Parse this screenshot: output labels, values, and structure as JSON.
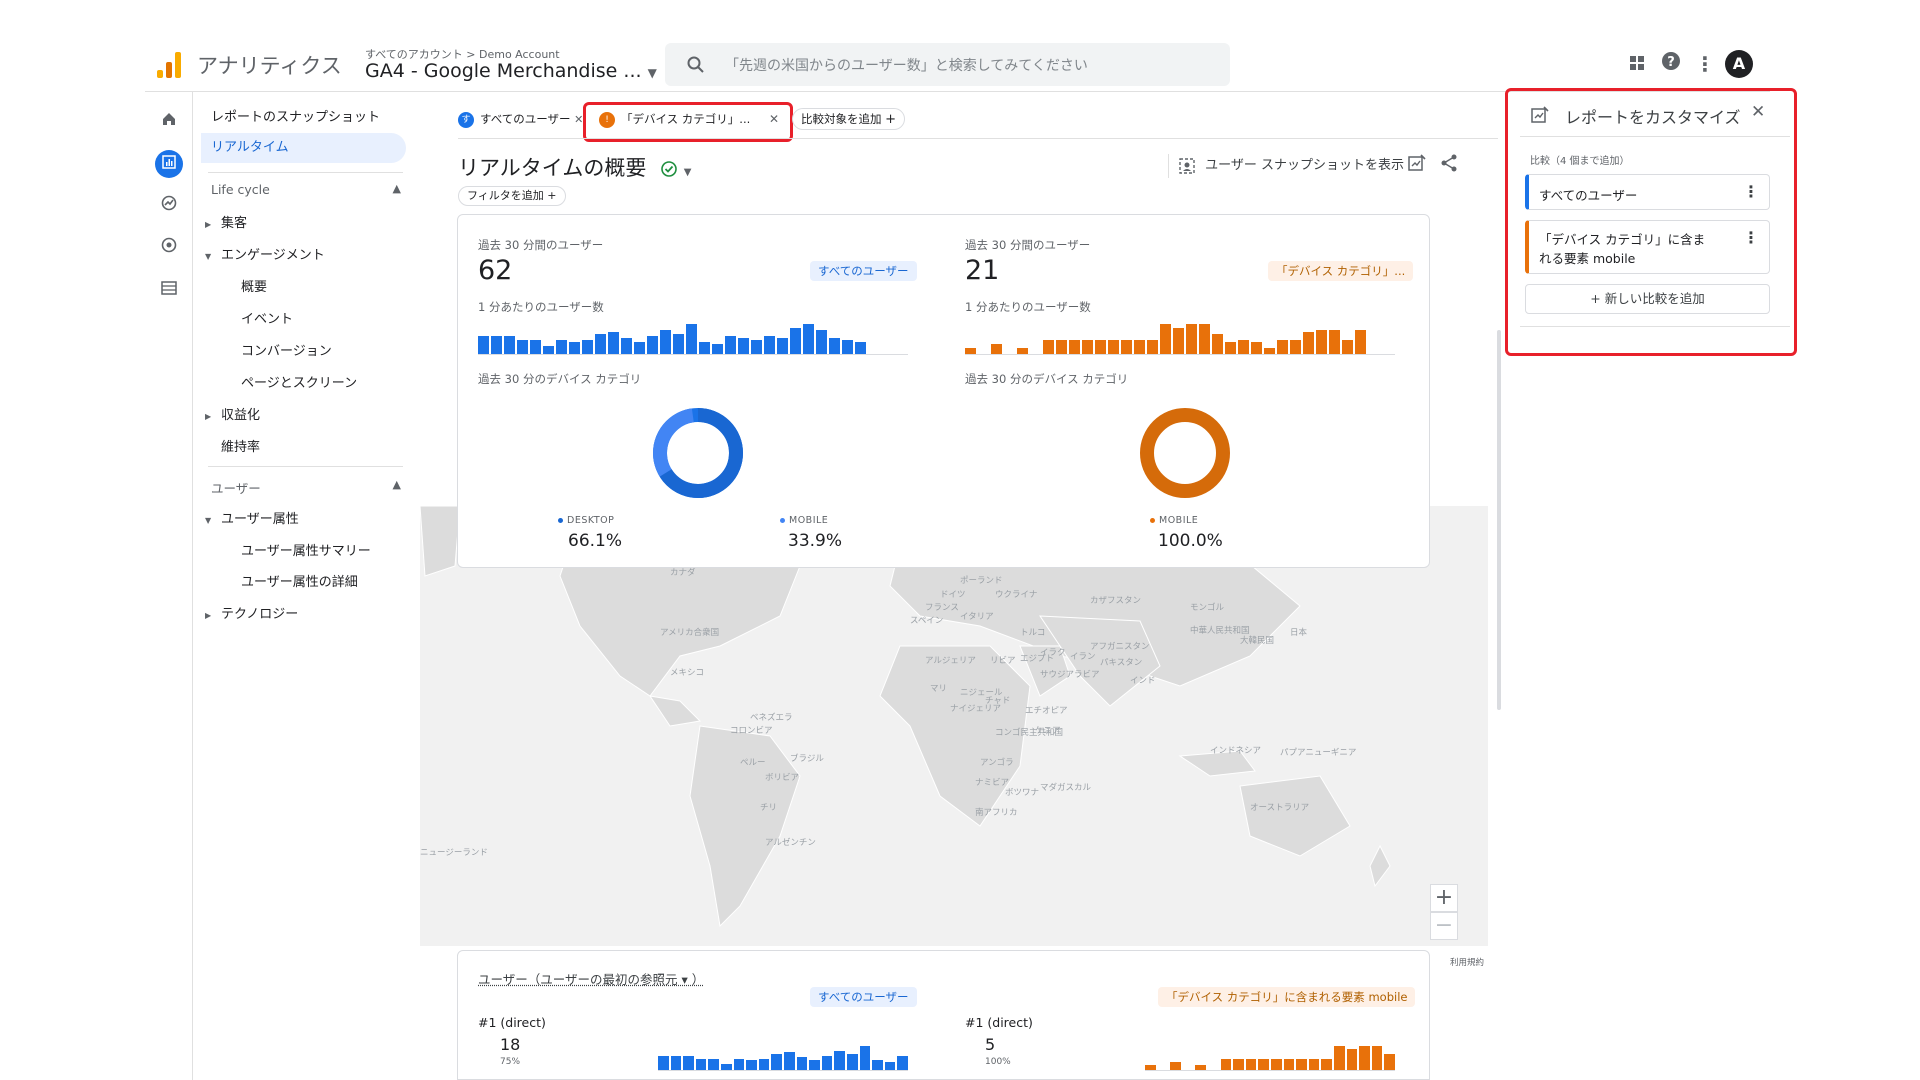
{
  "header": {
    "app_name": "アナリティクス",
    "breadcrumb": "すべてのアカウント > Demo Account",
    "property": "GA4 - Google Merchandise ...",
    "search_placeholder": "「先週の米国からのユーザー数」と検索してみてください",
    "avatar_letter": "A"
  },
  "nav": {
    "snapshot": "レポートのスナップショット",
    "realtime": "リアルタイム",
    "lifecycle": "Life cycle",
    "acquisition": "集客",
    "engagement": "エンゲージメント",
    "engagement_items": [
      "概要",
      "イベント",
      "コンバージョン",
      "ページとスクリーン"
    ],
    "monetization": "収益化",
    "retention": "維持率",
    "user": "ユーザー",
    "user_attributes": "ユーザー属性",
    "user_attribute_items": [
      "ユーザー属性サマリー",
      "ユーザー属性の詳細"
    ],
    "technology": "テクノロジー"
  },
  "comparisons": {
    "chip_all_users_dot": "す",
    "chip_all_users": "すべてのユーザー",
    "chip_device": "「デバイス カテゴリ」...",
    "add_comparison": "比較対象を追加"
  },
  "main": {
    "title": "リアルタイムの概要",
    "add_filter": "フィルタを追加",
    "snapshot_button": "ユーザー スナップショットを表示"
  },
  "card_left": {
    "users_label": "過去 30 分間のユーザー",
    "users_value": "62",
    "segment_tag": "すべてのユーザー",
    "per_minute_label": "1 分あたりのユーザー数",
    "device_label": "過去 30 分のデバイス カテゴリ",
    "legend": [
      {
        "name": "DESKTOP",
        "value": "66.1%"
      },
      {
        "name": "MOBILE",
        "value": "33.9%"
      }
    ]
  },
  "card_right": {
    "users_label": "過去 30 分間のユーザー",
    "users_value": "21",
    "segment_tag": "「デバイス カテゴリ」...",
    "per_minute_label": "1 分あたりのユーザー数",
    "device_label": "過去 30 分のデバイス カテゴリ",
    "legend": [
      {
        "name": "MOBILE",
        "value": "100.0%"
      }
    ]
  },
  "bars": {
    "left": [
      0.45,
      0.45,
      0.45,
      0.35,
      0.35,
      0.2,
      0.35,
      0.3,
      0.35,
      0.5,
      0.55,
      0.4,
      0.3,
      0.45,
      0.6,
      0.5,
      0.75,
      0.3,
      0.25,
      0.45,
      0.4,
      0.35,
      0.45,
      0.4,
      0.65,
      0.75,
      0.6,
      0.4,
      0.35,
      0.3
    ],
    "right": [
      0.15,
      0.0,
      0.25,
      0.0,
      0.15,
      0.0,
      0.35,
      0.35,
      0.35,
      0.35,
      0.35,
      0.35,
      0.35,
      0.35,
      0.35,
      0.75,
      0.65,
      0.75,
      0.75,
      0.5,
      0.3,
      0.35,
      0.3,
      0.15,
      0.35,
      0.35,
      0.55,
      0.6,
      0.6,
      0.35,
      0.6
    ]
  },
  "map_labels": [
    "カナダ",
    "アメリカ合衆国",
    "メキシコ",
    "ベネズエラ",
    "コロンビア",
    "ペルー",
    "ブラジル",
    "ボリビア",
    "チリ",
    "アルゼンチン",
    "ポーランド",
    "ドイツ",
    "ウクライナ",
    "フランス",
    "イタリア",
    "スペイン",
    "カザフスタン",
    "モンゴル",
    "中華人民共和国",
    "トルコ",
    "イラク",
    "イラン",
    "アフガニスタン",
    "パキスタン",
    "インド",
    "大韓民国",
    "日本",
    "アルジェリア",
    "リビア",
    "エジプト",
    "サウジアラビア",
    "マリ",
    "ニジェール",
    "チャド",
    "ナイジェリア",
    "エチオピア",
    "コンゴ民主共和国",
    "ケニア",
    "アンゴラ",
    "ナミビア",
    "ボツワナ",
    "マダガスカル",
    "南アフリカ",
    "インドネシア",
    "パプアニューギニア",
    "オーストラリア",
    "ニュージーランド"
  ],
  "bottom_card": {
    "title": "ユーザー（ユーザーの最初の参照元 ▾ ）",
    "tag_left": "すべてのユーザー",
    "tag_right": "「デバイス カテゴリ」に含まれる要素 mobile",
    "left": {
      "rank": "#1  (direct)",
      "value": "18",
      "pct": "75%"
    },
    "right": {
      "rank": "#1  (direct)",
      "value": "5",
      "pct": "100%"
    },
    "terms": "利用規約"
  },
  "panel": {
    "title": "レポートをカスタマイズ",
    "section_label": "比較（4 個まで追加）",
    "items": [
      "すべてのユーザー",
      "「デバイス カテゴリ」に含ま",
      "れる要素 mobile"
    ],
    "add_new": "新しい比較を追加"
  },
  "colors": {
    "blue": "#1a73e8",
    "orange": "#e8710a",
    "highlight": "#e8202a"
  }
}
